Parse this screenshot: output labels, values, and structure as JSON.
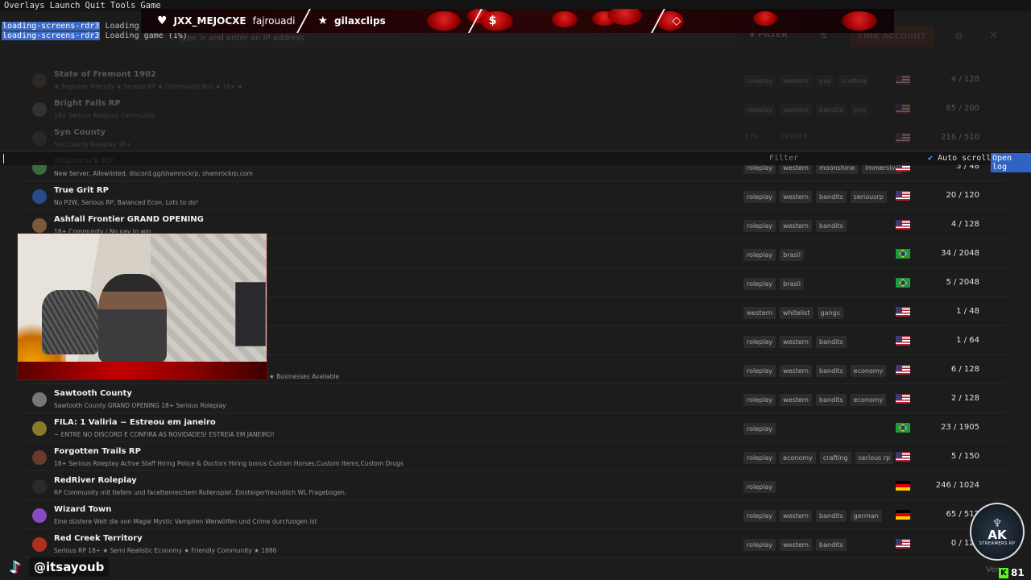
{
  "menubar": [
    "Overlays",
    "Launch",
    "Quit",
    "Tools",
    "Game"
  ],
  "log": [
    {
      "tag": "loading-screens-rdr3",
      "text": "Loading game"
    },
    {
      "tag": "loading-screens-rdr3",
      "text": "Loading game (1%)"
    }
  ],
  "banner": {
    "item1": "JXX_MEJOCXE",
    "item1b": "fajrouadi",
    "item2": "gilaxclips"
  },
  "header": {
    "search_placeholder": "type > and enter an IP address",
    "filter_label": "FILTER",
    "link_account_label": "LINK ACCOUNT"
  },
  "servers": [
    {
      "name": "State of Fremont 1902",
      "desc": "★ Beginner Friendly ★ Serious RP ★ Community Run ★ 18+ ★",
      "tags": [
        "roleplay",
        "western",
        "pvp",
        "crafting"
      ],
      "flag": "us",
      "players": "4 / 128",
      "dim": true
    },
    {
      "name": "Bright Falls RP",
      "desc": "18+ Serious Roleplay Community",
      "tags": [
        "roleplay",
        "western",
        "bandits",
        "pvp"
      ],
      "flag": "us",
      "players": "65 / 200",
      "dim": true
    },
    {
      "name": "Syn County",
      "desc": "Syn County Roleplay 18+",
      "tags": [],
      "flag": "us",
      "players": "216 / 510",
      "dim": true,
      "votes": "170",
      "upvote": "UPVOTE"
    },
    {
      "name": "Shamrock RP",
      "desc": "New Server, Allowlisted, discord.gg/shamrockrp, shamrockrp.com",
      "tags": [
        "roleplay",
        "western",
        "moonshine",
        "immersive"
      ],
      "flag": "us",
      "players": "5 / 48"
    },
    {
      "name": "True Grit RP",
      "desc": "No P2W, Serious RP, Balanced Econ, Lots to do!",
      "tags": [
        "roleplay",
        "western",
        "bandits",
        "seriousrp"
      ],
      "flag": "us",
      "players": "20 / 120"
    },
    {
      "name": "Ashfall Frontier GRAND OPENING",
      "desc": "18+ Community | No pay to win",
      "tags": [
        "roleplay",
        "western",
        "bandits"
      ],
      "flag": "us",
      "players": "4 / 128"
    },
    {
      "name": "",
      "desc": "",
      "tags": [
        "roleplay",
        "brasil"
      ],
      "flag": "br",
      "players": "34 / 2048"
    },
    {
      "name": "",
      "desc": "",
      "tags": [
        "roleplay",
        "brasil"
      ],
      "flag": "br",
      "players": "5 / 2048"
    },
    {
      "name": "",
      "desc": "",
      "tags": [
        "western",
        "whitelist",
        "gangs"
      ],
      "flag": "us",
      "players": "1 / 48"
    },
    {
      "name": "",
      "desc": "",
      "tags": [
        "roleplay",
        "western",
        "bandits"
      ],
      "flag": "us",
      "players": "1 / 64"
    },
    {
      "name": "",
      "desc": "",
      "tags": [
        "roleplay",
        "western",
        "bandits",
        "economy"
      ],
      "flag": "us",
      "players": "6 / 128"
    },
    {
      "name": "Sawtooth County",
      "desc": "Sawtooth County GRAND OPENING 18+ Serious Roleplay",
      "tags": [
        "roleplay",
        "western",
        "bandits",
        "economy"
      ],
      "flag": "us",
      "players": "2 / 128"
    },
    {
      "name": "FILA: 1 Valiria ~ Estreou em janeiro",
      "desc": "~ ENTRE NO DISCORD E CONFIRA AS NOVIDADES! ESTREIA EM JANEIRO!",
      "tags": [
        "roleplay"
      ],
      "flag": "br",
      "players": "23 / 1905"
    },
    {
      "name": "Forgotten Trails RP",
      "desc": "18+ Serious Roleplay Active Staff Hiring Police & Doctors Hiring bonus Custom Horses,Custom Items,Custom Drugs",
      "tags": [
        "roleplay",
        "economy",
        "crafting",
        "serious rp"
      ],
      "flag": "us",
      "players": "5 / 150"
    },
    {
      "name": "RedRiver Roleplay",
      "desc": "RP Community mit tiefem und facettenreichem Rollenspiel. Einsteigerfreundlich WL Fragebogen.",
      "tags": [
        "roleplay"
      ],
      "flag": "de",
      "players": "246 / 1024"
    },
    {
      "name": "Wizard Town",
      "desc": "Eine düstere Welt die von Magie Mystic Vampiren Werwölfen und Crime durchzogen ist",
      "tags": [
        "roleplay",
        "western",
        "bandits",
        "german"
      ],
      "flag": "de",
      "players": "65 / 512"
    },
    {
      "name": "Red Creek Territory",
      "desc": "Serious RP 18+ ★ Semi Realistic Economy ★ Friendly Community ★ 1886",
      "tags": [
        "roleplay",
        "western",
        "bandits"
      ],
      "flag": "us",
      "players": "0 / 128"
    }
  ],
  "console": {
    "filter_placeholder": "Filter",
    "autoscroll_check": "✔",
    "autoscroll_label": "Auto scroll",
    "open_log_label": "Open log"
  },
  "webcam_caption": "★ Businesses Available",
  "tiktok_handle": "@itsayoub",
  "emblem": {
    "ak": "AK",
    "sub": "STREAMERS RP"
  },
  "version_label": "Ver",
  "kick_count": "81"
}
